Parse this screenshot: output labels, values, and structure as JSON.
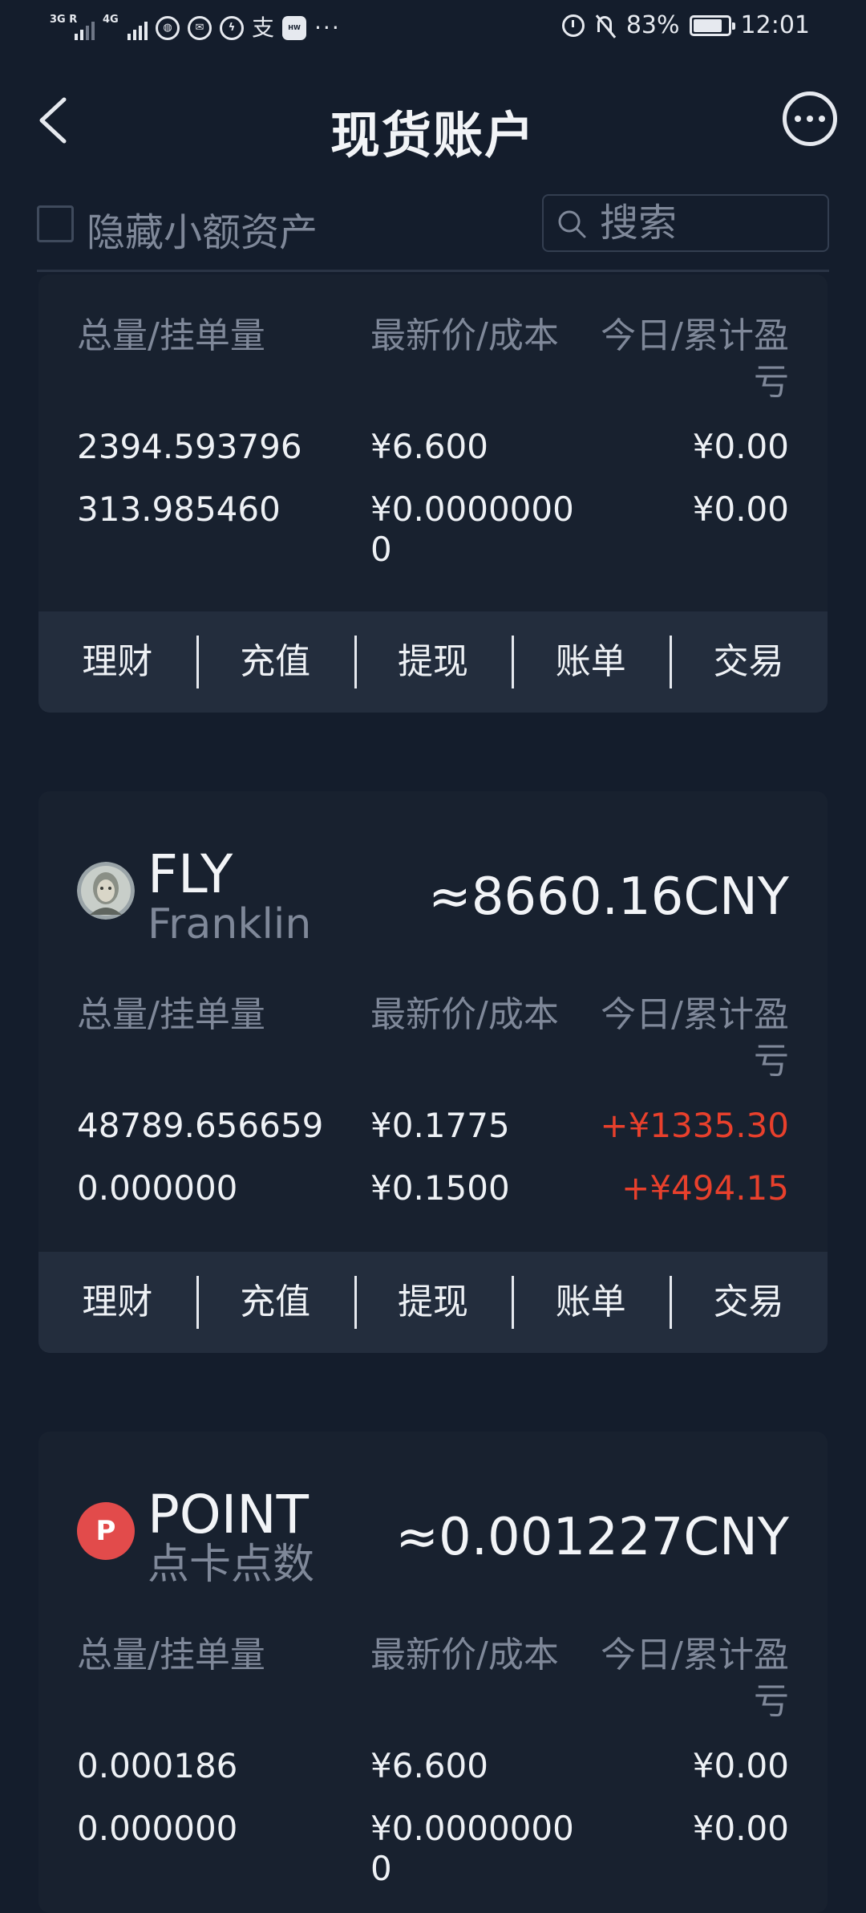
{
  "status_bar": {
    "network_1": "3G R",
    "network_2": "4G",
    "battery": "83%",
    "time": "12:01",
    "battery_level": 0.83
  },
  "header": {
    "title": "现货账户"
  },
  "filter": {
    "hide_small_label": "隐藏小额资产",
    "search_placeholder": "搜索"
  },
  "columns": {
    "amount": "总量/挂单量",
    "price": "最新价/成本",
    "pnl": "今日/累计盈亏"
  },
  "actions": [
    "理财",
    "充值",
    "提现",
    "账单",
    "交易"
  ],
  "assets": [
    {
      "rows": [
        {
          "amount": "2394.593796",
          "price": "¥6.600",
          "pnl": "¥0.00"
        },
        {
          "amount": "313.985460",
          "price": "¥0.00000000",
          "pnl": "¥0.00"
        }
      ]
    },
    {
      "symbol": "FLY",
      "name": "Franklin",
      "value": "≈8660.16CNY",
      "rows": [
        {
          "amount": "48789.656659",
          "price": "¥0.1775",
          "pnl": "+¥1335.30"
        },
        {
          "amount": "0.000000",
          "price": "¥0.1500",
          "pnl": "+¥494.15"
        }
      ]
    },
    {
      "symbol": "POINT",
      "name": "点卡点数",
      "value": "≈0.001227CNY",
      "icon_letter": "P",
      "rows": [
        {
          "amount": "0.000186",
          "price": "¥6.600",
          "pnl": "¥0.00"
        },
        {
          "amount": "0.000000",
          "price": "¥0.00000000",
          "pnl": "¥0.00"
        }
      ]
    }
  ],
  "colors": {
    "background": "#141d2c",
    "card": "#18212f",
    "action_bar": "#232d3d",
    "positive": "#e8402c",
    "muted": "#7f8899",
    "point_icon": "#e24b4b"
  }
}
